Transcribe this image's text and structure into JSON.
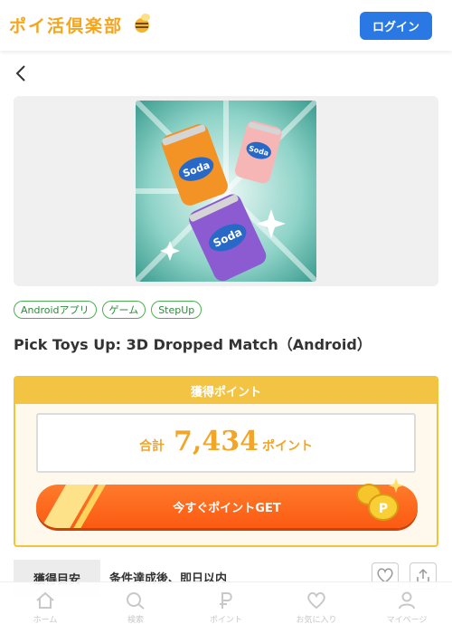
{
  "header": {
    "logo_text": "ポイ活倶楽部",
    "login_label": "ログイン"
  },
  "offer": {
    "tags": [
      "Androidアプリ",
      "ゲーム",
      "StepUp"
    ],
    "title": "Pick Toys Up: 3D Dropped Match（Android）",
    "hero_can_label": "Soda"
  },
  "points": {
    "header": "獲得ポイント",
    "total_label": "合計",
    "total_value": "7,434",
    "total_unit": "ポイント",
    "get_button_label": "今すぐポイントGET"
  },
  "criteria": {
    "label": "獲得目安",
    "text": "条件達成後、即日以内"
  },
  "tabbar": {
    "items": [
      {
        "label": "ホーム",
        "icon": "home-icon"
      },
      {
        "label": "検索",
        "icon": "search-icon"
      },
      {
        "label": "ポイント",
        "icon": "point-icon"
      },
      {
        "label": "お気に入り",
        "icon": "heart-icon"
      },
      {
        "label": "マイページ",
        "icon": "user-icon"
      }
    ]
  },
  "colors": {
    "brand": "#f4a51c",
    "login": "#2a78e4",
    "points_accent": "#f2a527",
    "get_button": "#fb5a12",
    "tag_border": "#4caf50"
  }
}
